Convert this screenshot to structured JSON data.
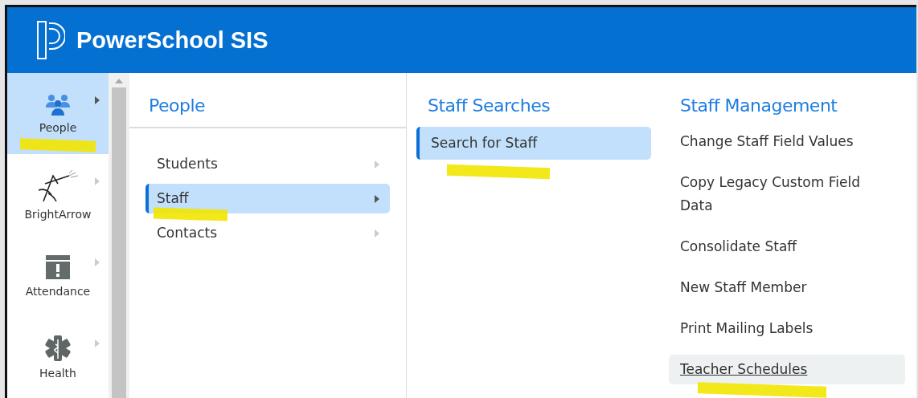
{
  "header": {
    "title": "PowerSchool SIS"
  },
  "sidebar": {
    "items": [
      {
        "label": "People",
        "kind": "people",
        "selected": true,
        "highlighted": true
      },
      {
        "label": "BrightArrow",
        "kind": "arrow",
        "selected": false,
        "highlighted": false
      },
      {
        "label": "Attendance",
        "kind": "calendar",
        "selected": false,
        "highlighted": false
      },
      {
        "label": "Health",
        "kind": "medical",
        "selected": false,
        "highlighted": false
      }
    ]
  },
  "category_panel": {
    "title": "People",
    "items": [
      {
        "label": "Students",
        "selected": false,
        "highlighted": false
      },
      {
        "label": "Staff",
        "selected": true,
        "highlighted": true
      },
      {
        "label": "Contacts",
        "selected": false,
        "highlighted": false
      }
    ]
  },
  "searches_panel": {
    "title": "Staff Searches",
    "items": [
      {
        "label": "Search for Staff",
        "selected": true,
        "highlighted": true
      }
    ]
  },
  "management_panel": {
    "title": "Staff Management",
    "items": [
      {
        "label": "Change Staff Field Values",
        "hovered": false,
        "highlighted": false
      },
      {
        "label": "Copy Legacy Custom Field Data",
        "hovered": false,
        "highlighted": false
      },
      {
        "label": "Consolidate Staff",
        "hovered": false,
        "highlighted": false
      },
      {
        "label": "New Staff Member",
        "hovered": false,
        "highlighted": false
      },
      {
        "label": "Print Mailing Labels",
        "hovered": false,
        "highlighted": false
      },
      {
        "label": "Teacher Schedules",
        "hovered": true,
        "highlighted": true
      }
    ]
  }
}
